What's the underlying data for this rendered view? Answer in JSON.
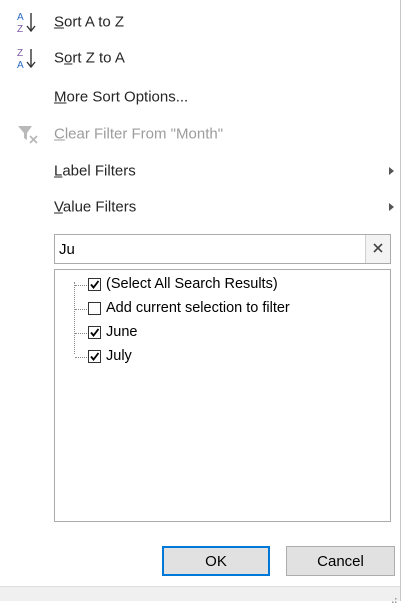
{
  "menu": {
    "sort_az": {
      "pre": "",
      "mn": "S",
      "post": "ort A to Z"
    },
    "sort_za": {
      "pre": "S",
      "mn": "o",
      "post": "rt Z to A"
    },
    "more_sort": {
      "pre": "",
      "mn": "M",
      "post": "ore Sort Options..."
    },
    "clear_filter": {
      "pre": "",
      "mn": "C",
      "post": "lear Filter From \"Month\""
    },
    "label_filters": {
      "pre": "",
      "mn": "L",
      "post": "abel Filters"
    },
    "value_filters": {
      "pre": "",
      "mn": "V",
      "post": "alue Filters"
    }
  },
  "icons": {
    "sort_az": "sort-ascending-icon",
    "sort_za": "sort-descending-icon",
    "clear_filter": "clear-filter-icon",
    "submenu": "chevron-right-icon",
    "clear_search": "close-icon"
  },
  "search": {
    "value": "Ju"
  },
  "items": [
    {
      "label": "(Select All Search Results)",
      "checked": true
    },
    {
      "label": "Add current selection to filter",
      "checked": false
    },
    {
      "label": "June",
      "checked": true
    },
    {
      "label": "July",
      "checked": true
    }
  ],
  "buttons": {
    "ok": "OK",
    "cancel": "Cancel"
  },
  "colors": {
    "accent": "#0078d7",
    "disabled_text": "#9c9c9c",
    "icon_purple": "#7b5aa6",
    "icon_blue": "#2b6cc4"
  }
}
